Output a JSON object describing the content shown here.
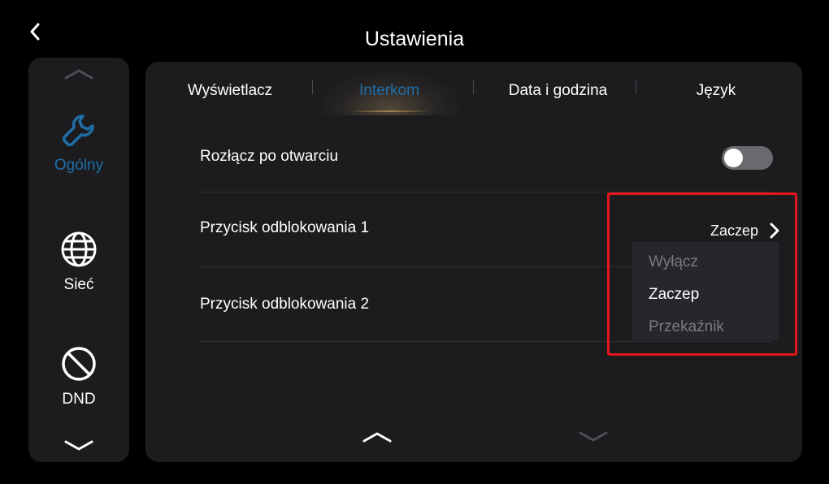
{
  "header": {
    "title": "Ustawienia"
  },
  "sidebar": {
    "items": [
      {
        "label": "Ogólny",
        "icon": "wrench-icon",
        "active": true
      },
      {
        "label": "Sieć",
        "icon": "globe-icon",
        "active": false
      },
      {
        "label": "DND",
        "icon": "do-not-disturb-icon",
        "active": false
      }
    ]
  },
  "tabs": [
    {
      "label": "Wyświetlacz",
      "active": false
    },
    {
      "label": "Interkom",
      "active": true
    },
    {
      "label": "Data i godzina",
      "active": false
    },
    {
      "label": "Język",
      "active": false
    }
  ],
  "settings": {
    "disconnect_after_open": {
      "label": "Rozłącz po otwarciu",
      "enabled": false
    },
    "unlock_button_1": {
      "label": "Przycisk odblokowania 1",
      "value": "Zaczep"
    },
    "unlock_button_2": {
      "label": "Przycisk odblokowania 2"
    }
  },
  "dropdown": {
    "options": [
      "Wyłącz",
      "Zaczep",
      "Przekaźnik"
    ],
    "selected": "Zaczep"
  },
  "colors": {
    "background": "#000000",
    "panel": "#1c1c1f",
    "accent_blue": "#1f6ea8",
    "toggle_off": "#6a6a6e",
    "highlight_red": "#e4161c",
    "dropdown_bg": "#26262b",
    "dim_text": "#7a7a80"
  }
}
